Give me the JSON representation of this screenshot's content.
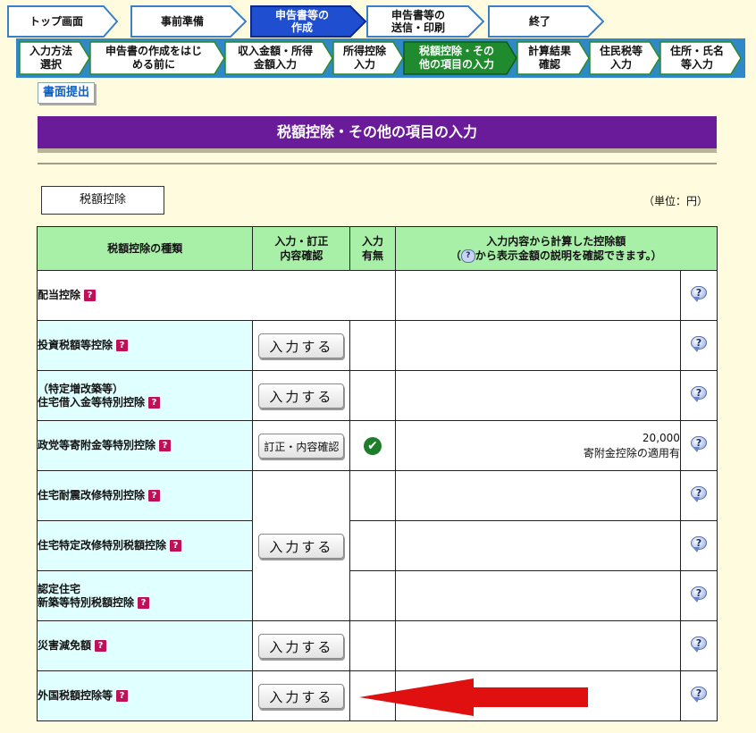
{
  "steps": [
    {
      "label": "トップ画面",
      "active": false
    },
    {
      "label": "事前準備",
      "active": false
    },
    {
      "label": "申告書等の\n作成",
      "active": true
    },
    {
      "label": "申告書等の\n送信・印刷",
      "active": false
    },
    {
      "label": "終了",
      "active": false
    }
  ],
  "substeps": [
    {
      "label": "入力方法\n選択",
      "active": false
    },
    {
      "label": "申告書の作成をはじ\nめる前に",
      "active": false
    },
    {
      "label": "収入金額・所得\n金額入力",
      "active": false
    },
    {
      "label": "所得控除\n入力",
      "active": false
    },
    {
      "label": "税額控除・その\n他の項目の入力",
      "active": true
    },
    {
      "label": "計算結果\n確認",
      "active": false
    },
    {
      "label": "住民税等\n入力",
      "active": false
    },
    {
      "label": "住所・氏名\n等入力",
      "active": false
    }
  ],
  "submit_label": "書面提出",
  "page_title": "税額控除・その他の項目の入力",
  "section_label": "税額控除",
  "unit_label": "（単位：円）",
  "table": {
    "headers": {
      "type": "税額控除の種類",
      "confirm": "入力・訂正\n内容確認",
      "status": "入力\n有無",
      "amount_line1": "入力内容から計算した控除額",
      "amount_line2_pre": "（",
      "amount_line2_icon": "?",
      "amount_line2_post": "から表示金額の説明を確認できます。）"
    },
    "help_badge": "?",
    "rows": [
      {
        "name": "配当控除"
      },
      {
        "name": "投資税額等控除",
        "button": "入力する"
      },
      {
        "name": "（特定増改築等）\n住宅借入金等特別控除",
        "button": "入力する"
      },
      {
        "name": "政党等寄附金等特別控除",
        "button": "訂正・内容確認",
        "amount": "20,000",
        "amount_note": "寄附金控除の適用有",
        "status": "✔"
      },
      {
        "name": "住宅耐震改修特別控除"
      },
      {
        "name": "住宅特定改修特別税額控除",
        "button": "入力する"
      },
      {
        "name": "認定住宅\n新築等特別税額控除"
      },
      {
        "name": "災害減免額",
        "button": "入力する"
      },
      {
        "name": "外国税額控除等",
        "button": "入力する"
      }
    ]
  },
  "colors": {
    "title_bg": "#6a1b9a",
    "active_step": "#1f4fd0",
    "active_sub": "#1f8a2e",
    "header_green": "#a8f0a8",
    "arrow": "#e01010"
  }
}
